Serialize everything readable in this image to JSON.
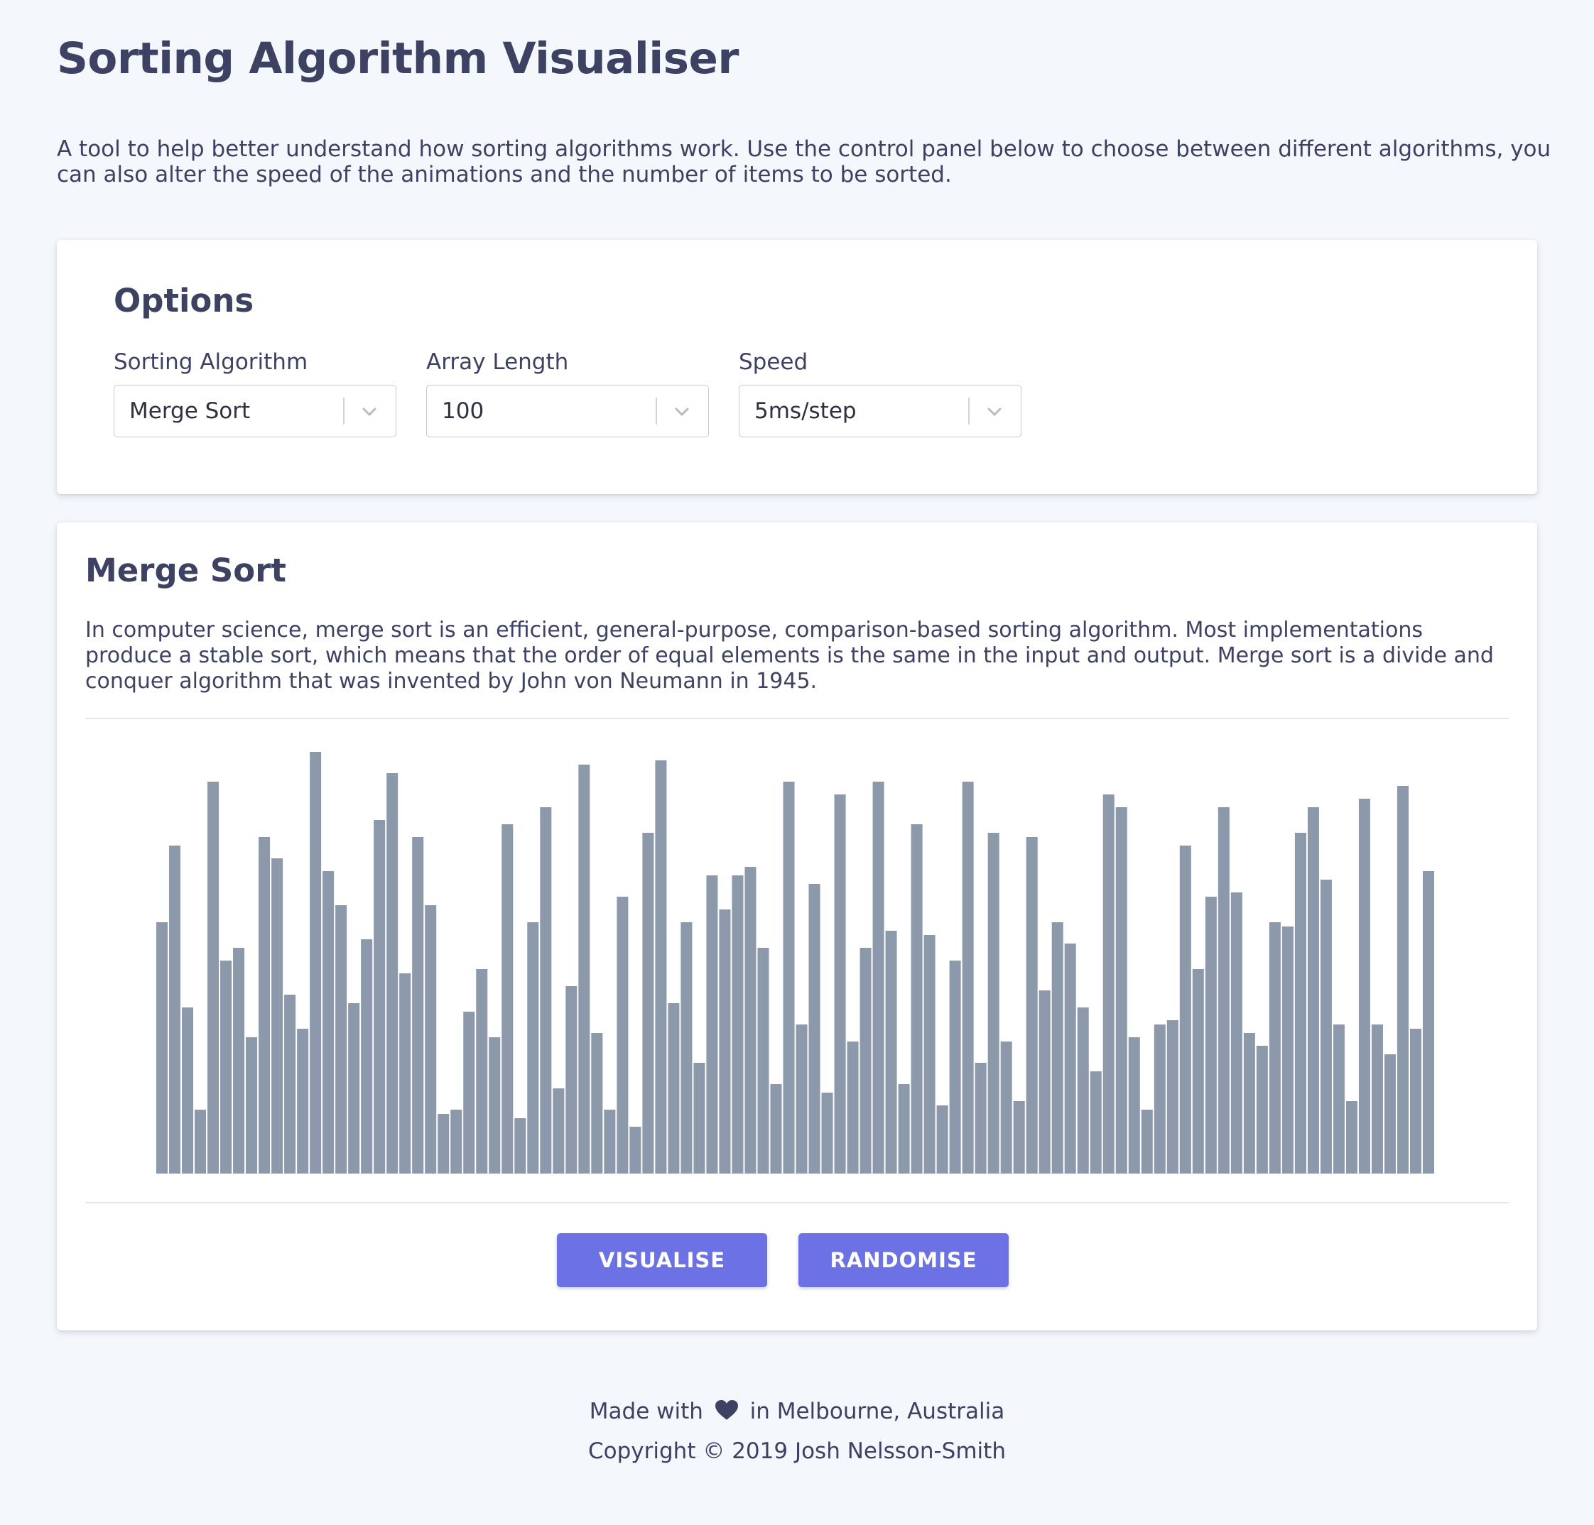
{
  "page": {
    "title": "Sorting Algorithm Visualiser",
    "intro": "A tool to help better understand how sorting algorithms work. Use the control panel below to choose between different algorithms, you can also alter the speed of the animations and the number of items to be sorted."
  },
  "options": {
    "title": "Options",
    "algorithm": {
      "label": "Sorting Algorithm",
      "value": "Merge Sort"
    },
    "length": {
      "label": "Array Length",
      "value": "100"
    },
    "speed": {
      "label": "Speed",
      "value": "5ms/step"
    }
  },
  "visualiser": {
    "title": "Merge Sort",
    "description": "In computer science, merge sort is an efficient, general-purpose, comparison-based sorting algorithm. Most implementations produce a stable sort, which means that the order of equal elements is the same in the input and output. Merge sort is a divide and conquer algorithm that was invented by John von Neumann in 1945.",
    "bar_color": "#8b99ab",
    "visualise_label": "VISUALISE",
    "randomise_label": "RANDOMISE"
  },
  "chart_data": {
    "type": "bar",
    "categories": [],
    "ylim": [
      0,
      100
    ],
    "values": [
      59,
      77,
      39,
      15,
      92,
      50,
      53,
      32,
      79,
      74,
      42,
      34,
      99,
      71,
      63,
      40,
      55,
      83,
      94,
      47,
      79,
      63,
      14,
      15,
      38,
      48,
      32,
      82,
      13,
      59,
      86,
      20,
      44,
      96,
      33,
      15,
      65,
      11,
      80,
      97,
      40,
      59,
      26,
      70,
      62,
      70,
      72,
      53,
      21,
      92,
      35,
      68,
      19,
      89,
      31,
      53,
      92,
      57,
      21,
      82,
      56,
      16,
      50,
      92,
      26,
      80,
      31,
      17,
      79,
      43,
      59,
      54,
      39,
      24,
      89,
      86,
      32,
      15,
      35,
      36,
      77,
      48,
      65,
      86,
      66,
      33,
      30,
      59,
      58,
      80,
      86,
      69,
      35,
      17,
      88,
      35,
      28,
      91,
      34,
      71
    ],
    "colors": {
      "bar": "#8b99ab",
      "accent": "#6c71e3"
    }
  },
  "footer": {
    "made_prefix": "Made with",
    "made_suffix": "in Melbourne, Australia",
    "copyright": "Copyright © 2019 Josh Nelsson-Smith"
  }
}
